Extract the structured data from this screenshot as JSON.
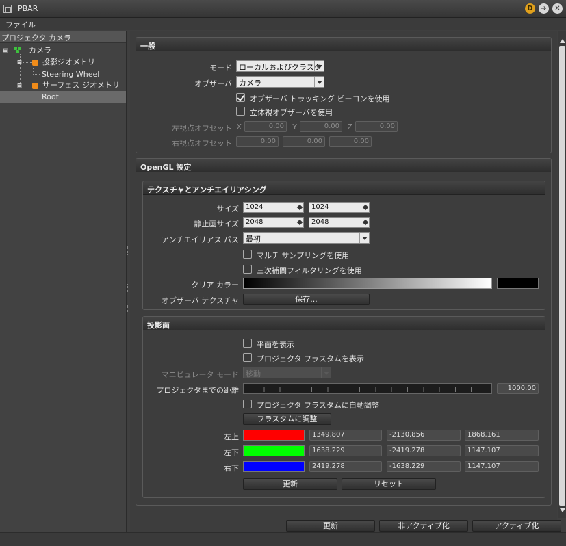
{
  "window": {
    "title": "PBAR"
  },
  "menu": {
    "file": "ファイル"
  },
  "tree": {
    "header": "プロジェクタ カメラ",
    "camera": "カメラ",
    "projection_geometry": "投影ジオメトリ",
    "steering_wheel": "Steering Wheel",
    "surface_geometry": "サーフェス ジオメトリ",
    "roof": "Roof"
  },
  "general": {
    "title": "一般",
    "mode_label": "モード",
    "mode_value": "ローカルおよびクラスタ",
    "observer_label": "オブザーバ",
    "observer_value": "カメラ",
    "tracking_beacon": "オブザーバ トラッキング ビーコンを使用",
    "tracking_beacon_checked": true,
    "stereo_observer": "立体視オブザーバを使用",
    "stereo_observer_checked": false,
    "left_offset_label": "左視点オフセット",
    "x": "X",
    "y": "Y",
    "z": "Z",
    "left_offset_x": "0.00",
    "left_offset_y": "0.00",
    "left_offset_z": "0.00",
    "right_offset_label": "右視点オフセット",
    "right_offset_x": "0.00",
    "right_offset_y": "0.00",
    "right_offset_z": "0.00"
  },
  "opengl": {
    "title": "OpenGL 設定",
    "texture": {
      "title": "テクスチャとアンチエイリアシング",
      "size_label": "サイズ",
      "size_w": "1024",
      "size_h": "1024",
      "still_size_label": "静止画サイズ",
      "still_w": "2048",
      "still_h": "2048",
      "antialias_label": "アンチエイリアス パス",
      "antialias_value": "最初",
      "multisampling": "マルチ サンプリングを使用",
      "cubic_filtering": "三次補間フィルタリングを使用",
      "clear_color_label": "クリア カラー",
      "observer_texture_label": "オブザーバ テクスチャ",
      "save_button": "保存..."
    },
    "projection": {
      "title": "投影面",
      "show_plane": "平面を表示",
      "show_frustum": "プロジェクタ フラスタムを表示",
      "manipulator_label": "マニピュレータ モード",
      "manipulator_value": "移動",
      "distance_label": "プロジェクタまでの距離",
      "distance_value": "1000.00",
      "auto_fit": "プロジェクタ フラスタムに自動調整",
      "fit_button": "フラスタムに調整",
      "top_left_label": "左上",
      "bottom_left_label": "左下",
      "bottom_right_label": "右下",
      "tl": [
        "1349.807",
        "-2130.856",
        "1868.161"
      ],
      "bl": [
        "1638.229",
        "-2419.278",
        "1147.107"
      ],
      "br": [
        "2419.278",
        "-1638.229",
        "1147.107"
      ],
      "colors": {
        "tl": "#ff0000",
        "bl": "#00ff00",
        "br": "#0000ff"
      },
      "update_button": "更新",
      "reset_button": "リセット"
    }
  },
  "footer": {
    "update": "更新",
    "deactivate": "非アクティブ化",
    "activate": "アクティブ化"
  }
}
